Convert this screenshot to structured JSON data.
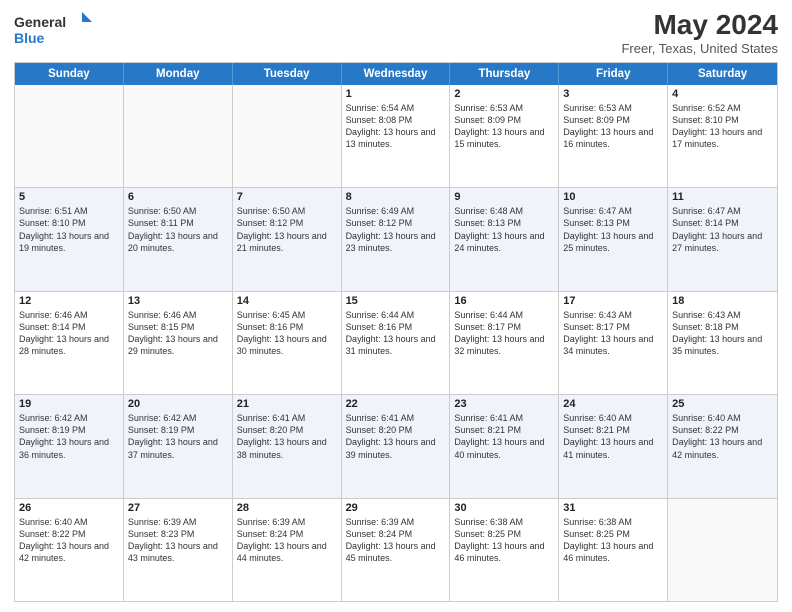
{
  "header": {
    "logo_line1": "General",
    "logo_line2": "Blue",
    "title": "May 2024",
    "subtitle": "Freer, Texas, United States"
  },
  "days_of_week": [
    "Sunday",
    "Monday",
    "Tuesday",
    "Wednesday",
    "Thursday",
    "Friday",
    "Saturday"
  ],
  "weeks": [
    [
      {
        "num": "",
        "info": ""
      },
      {
        "num": "",
        "info": ""
      },
      {
        "num": "",
        "info": ""
      },
      {
        "num": "1",
        "info": "Sunrise: 6:54 AM\nSunset: 8:08 PM\nDaylight: 13 hours and 13 minutes."
      },
      {
        "num": "2",
        "info": "Sunrise: 6:53 AM\nSunset: 8:09 PM\nDaylight: 13 hours and 15 minutes."
      },
      {
        "num": "3",
        "info": "Sunrise: 6:53 AM\nSunset: 8:09 PM\nDaylight: 13 hours and 16 minutes."
      },
      {
        "num": "4",
        "info": "Sunrise: 6:52 AM\nSunset: 8:10 PM\nDaylight: 13 hours and 17 minutes."
      }
    ],
    [
      {
        "num": "5",
        "info": "Sunrise: 6:51 AM\nSunset: 8:10 PM\nDaylight: 13 hours and 19 minutes."
      },
      {
        "num": "6",
        "info": "Sunrise: 6:50 AM\nSunset: 8:11 PM\nDaylight: 13 hours and 20 minutes."
      },
      {
        "num": "7",
        "info": "Sunrise: 6:50 AM\nSunset: 8:12 PM\nDaylight: 13 hours and 21 minutes."
      },
      {
        "num": "8",
        "info": "Sunrise: 6:49 AM\nSunset: 8:12 PM\nDaylight: 13 hours and 23 minutes."
      },
      {
        "num": "9",
        "info": "Sunrise: 6:48 AM\nSunset: 8:13 PM\nDaylight: 13 hours and 24 minutes."
      },
      {
        "num": "10",
        "info": "Sunrise: 6:47 AM\nSunset: 8:13 PM\nDaylight: 13 hours and 25 minutes."
      },
      {
        "num": "11",
        "info": "Sunrise: 6:47 AM\nSunset: 8:14 PM\nDaylight: 13 hours and 27 minutes."
      }
    ],
    [
      {
        "num": "12",
        "info": "Sunrise: 6:46 AM\nSunset: 8:14 PM\nDaylight: 13 hours and 28 minutes."
      },
      {
        "num": "13",
        "info": "Sunrise: 6:46 AM\nSunset: 8:15 PM\nDaylight: 13 hours and 29 minutes."
      },
      {
        "num": "14",
        "info": "Sunrise: 6:45 AM\nSunset: 8:16 PM\nDaylight: 13 hours and 30 minutes."
      },
      {
        "num": "15",
        "info": "Sunrise: 6:44 AM\nSunset: 8:16 PM\nDaylight: 13 hours and 31 minutes."
      },
      {
        "num": "16",
        "info": "Sunrise: 6:44 AM\nSunset: 8:17 PM\nDaylight: 13 hours and 32 minutes."
      },
      {
        "num": "17",
        "info": "Sunrise: 6:43 AM\nSunset: 8:17 PM\nDaylight: 13 hours and 34 minutes."
      },
      {
        "num": "18",
        "info": "Sunrise: 6:43 AM\nSunset: 8:18 PM\nDaylight: 13 hours and 35 minutes."
      }
    ],
    [
      {
        "num": "19",
        "info": "Sunrise: 6:42 AM\nSunset: 8:19 PM\nDaylight: 13 hours and 36 minutes."
      },
      {
        "num": "20",
        "info": "Sunrise: 6:42 AM\nSunset: 8:19 PM\nDaylight: 13 hours and 37 minutes."
      },
      {
        "num": "21",
        "info": "Sunrise: 6:41 AM\nSunset: 8:20 PM\nDaylight: 13 hours and 38 minutes."
      },
      {
        "num": "22",
        "info": "Sunrise: 6:41 AM\nSunset: 8:20 PM\nDaylight: 13 hours and 39 minutes."
      },
      {
        "num": "23",
        "info": "Sunrise: 6:41 AM\nSunset: 8:21 PM\nDaylight: 13 hours and 40 minutes."
      },
      {
        "num": "24",
        "info": "Sunrise: 6:40 AM\nSunset: 8:21 PM\nDaylight: 13 hours and 41 minutes."
      },
      {
        "num": "25",
        "info": "Sunrise: 6:40 AM\nSunset: 8:22 PM\nDaylight: 13 hours and 42 minutes."
      }
    ],
    [
      {
        "num": "26",
        "info": "Sunrise: 6:40 AM\nSunset: 8:22 PM\nDaylight: 13 hours and 42 minutes."
      },
      {
        "num": "27",
        "info": "Sunrise: 6:39 AM\nSunset: 8:23 PM\nDaylight: 13 hours and 43 minutes."
      },
      {
        "num": "28",
        "info": "Sunrise: 6:39 AM\nSunset: 8:24 PM\nDaylight: 13 hours and 44 minutes."
      },
      {
        "num": "29",
        "info": "Sunrise: 6:39 AM\nSunset: 8:24 PM\nDaylight: 13 hours and 45 minutes."
      },
      {
        "num": "30",
        "info": "Sunrise: 6:38 AM\nSunset: 8:25 PM\nDaylight: 13 hours and 46 minutes."
      },
      {
        "num": "31",
        "info": "Sunrise: 6:38 AM\nSunset: 8:25 PM\nDaylight: 13 hours and 46 minutes."
      },
      {
        "num": "",
        "info": ""
      }
    ]
  ]
}
